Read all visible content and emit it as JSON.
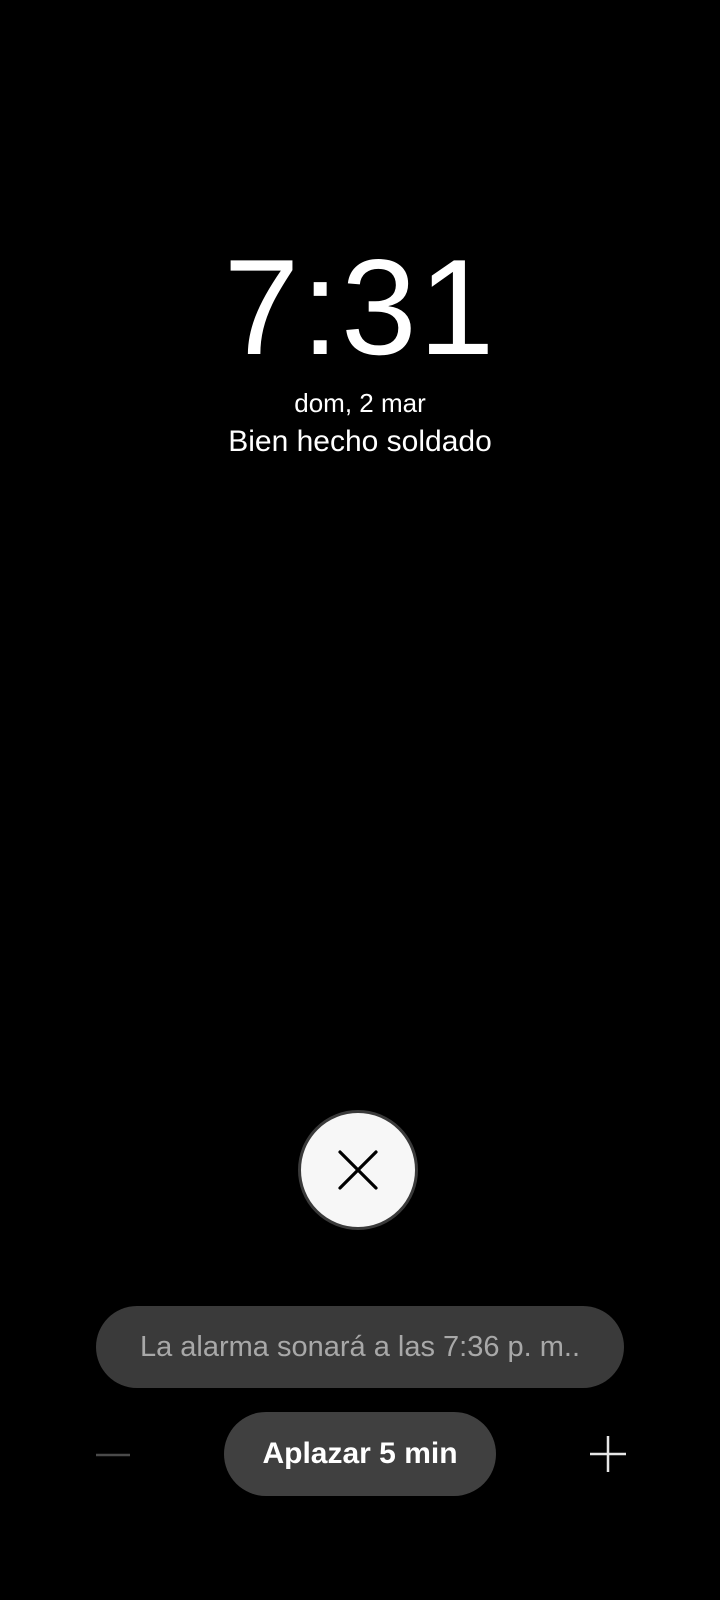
{
  "alarm": {
    "time": "7:31",
    "date": "dom, 2 mar",
    "label": "Bien hecho soldado"
  },
  "dismiss": {
    "icon": "close-icon"
  },
  "snooze_info": {
    "text": "La alarma sonará a las 7:36 p. m.."
  },
  "snooze": {
    "button_label": "Aplazar 5 min",
    "decrease_icon": "minus-icon",
    "increase_icon": "plus-icon"
  },
  "colors": {
    "background": "#000000",
    "dismiss_button": "#f7f7f7",
    "pill": "#3a3a3a",
    "snooze_button": "#404040",
    "muted_text": "#a8a8a8"
  }
}
